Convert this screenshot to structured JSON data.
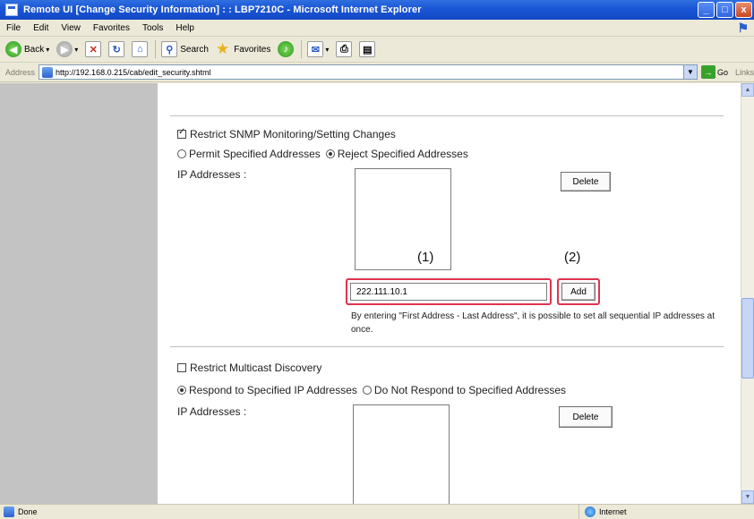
{
  "window": {
    "title": "Remote UI [Change Security Information] : : LBP7210C - Microsoft Internet Explorer",
    "minimize": "_",
    "maximize": "□",
    "close": "x"
  },
  "menu": [
    "File",
    "Edit",
    "View",
    "Favorites",
    "Tools",
    "Help"
  ],
  "toolbar": {
    "back_label": "Back",
    "search_label": "Search",
    "favorites_label": "Favorites"
  },
  "address": {
    "label": "Address",
    "url": "http://192.168.0.215/cab/edit_security.shtml",
    "go_label": "Go",
    "links_label": "Links"
  },
  "snmp": {
    "checkbox_label": "Restrict SNMP Monitoring/Setting Changes",
    "checked": true,
    "radio_permit": "Permit Specified Addresses",
    "radio_reject": "Reject Specified Addresses",
    "selected_radio": "reject",
    "ip_label": "IP Addresses :",
    "delete_button": "Delete",
    "ip_input_value": "222.111.10.1",
    "add_button": "Add",
    "callout_1": "(1)",
    "callout_2": "(2)",
    "note": "By entering \"First Address - Last Address\", it is possible to set all sequential IP addresses at once."
  },
  "multicast": {
    "checkbox_label": "Restrict Multicast Discovery",
    "checked": false,
    "radio_respond": "Respond to Specified IP Addresses",
    "radio_no_respond": "Do Not Respond to Specified Addresses",
    "selected_radio": "respond",
    "ip_label": "IP Addresses :",
    "delete_button": "Delete"
  },
  "status": {
    "left": "Done",
    "zone": "Internet"
  }
}
